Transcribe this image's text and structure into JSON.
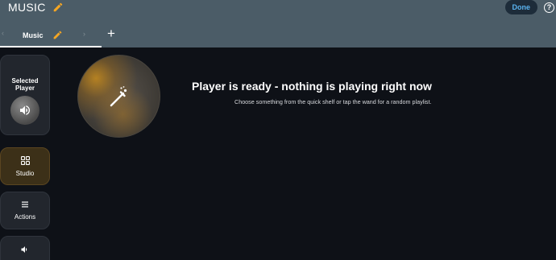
{
  "header": {
    "title": "MUSIC",
    "done_label": "Done",
    "help_label": "?"
  },
  "tabs": [
    {
      "label": "Music",
      "active": true
    }
  ],
  "add_tab_label": "+",
  "sidebar": {
    "selected_player_label": "Selected\nPlayer",
    "items": [
      {
        "label": "Studio",
        "icon": "grid-icon",
        "active": true
      },
      {
        "label": "Actions",
        "icon": "list-icon",
        "active": false
      },
      {
        "label": "",
        "icon": "volume-icon",
        "active": false
      }
    ]
  },
  "main": {
    "headline": "Player is ready - nothing is playing right now",
    "subline": "Choose something from the quick shelf or tap the wand for a random playlist."
  },
  "colors": {
    "header_bg": "#4b5c67",
    "page_bg": "#0e1117",
    "accent_orange": "#f5a623",
    "done_text": "#5ab3ef"
  }
}
